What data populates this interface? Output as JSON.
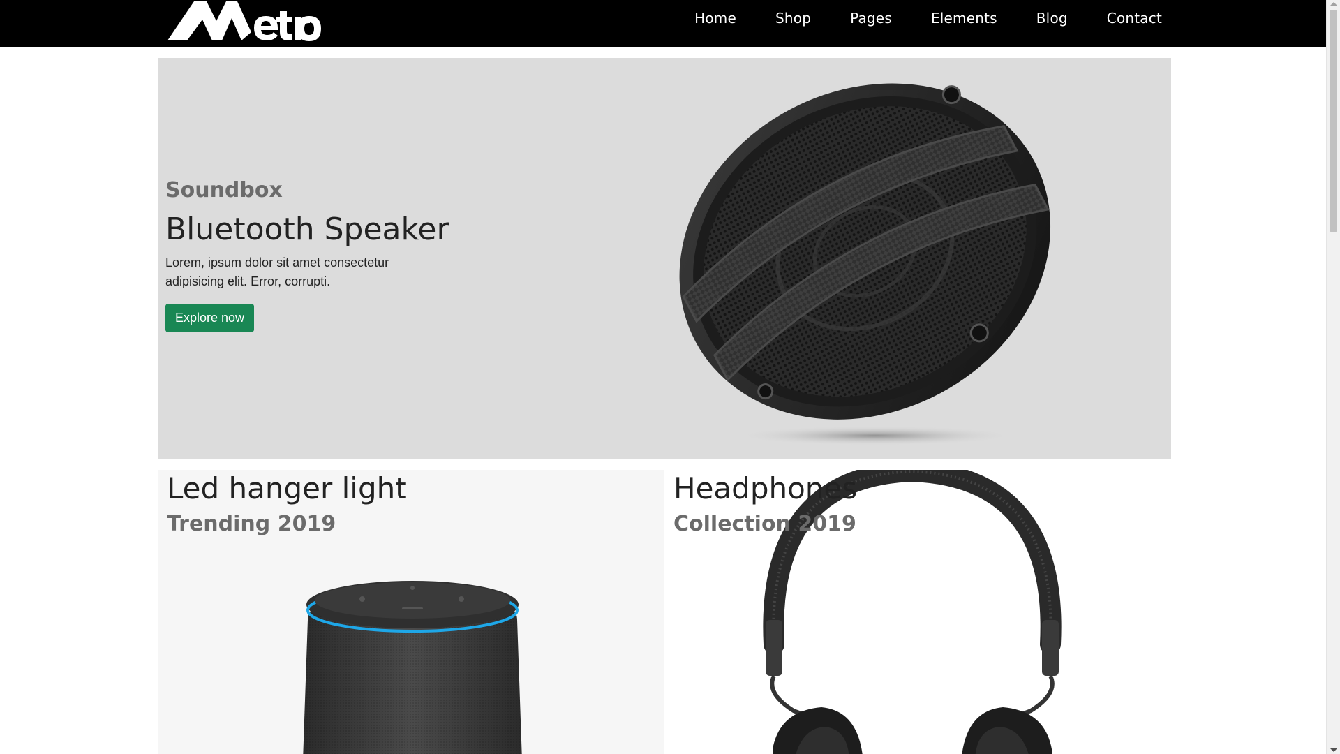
{
  "brand": {
    "logo_text": "Metro"
  },
  "nav": {
    "items": [
      {
        "label": "Home"
      },
      {
        "label": "Shop"
      },
      {
        "label": "Pages"
      },
      {
        "label": "Elements"
      },
      {
        "label": "Blog"
      },
      {
        "label": "Contact"
      }
    ]
  },
  "hero": {
    "subtitle": "Soundbox",
    "title": "Bluetooth Speaker",
    "description": "Lorem, ipsum dolor sit amet consectetur adipisicing elit. Error, corrupti.",
    "button_label": "Explore now",
    "button_color": "#198754",
    "background_color": "#dcdcdc",
    "image_icon": "car-speaker-image"
  },
  "cards": [
    {
      "title": "Led hanger light",
      "subtitle": "Trending 2019",
      "image_icon": "smart-speaker-image"
    },
    {
      "title": "Headphones",
      "subtitle": "Collection 2019",
      "image_icon": "headphones-image"
    }
  ],
  "colors": {
    "navbar": "#000000",
    "text_dark": "#222222",
    "text_muted": "#6b6b6b"
  }
}
